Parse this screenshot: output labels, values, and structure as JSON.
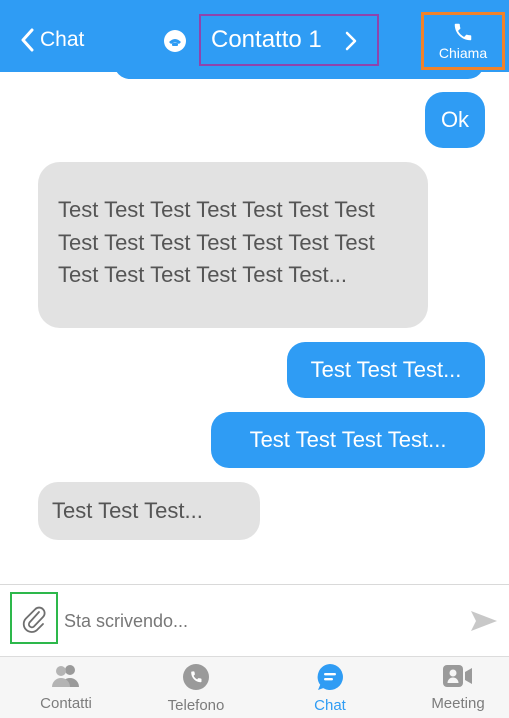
{
  "header": {
    "back_label": "Chat",
    "contact_name": "Contatto 1",
    "call_label": "Chiama",
    "accent": "#2f9cf4"
  },
  "messages": [
    {
      "direction": "outgoing",
      "text": "Ok"
    },
    {
      "direction": "incoming",
      "text": "Test Test Test Test Test Test Test Test Test Test Test Test Test Test Test Test Test Test Test Test..."
    },
    {
      "direction": "outgoing",
      "text": "Test Test Test..."
    },
    {
      "direction": "outgoing",
      "text": "Test Test Test Test..."
    },
    {
      "direction": "incoming",
      "text": "Test Test Test..."
    }
  ],
  "composer": {
    "placeholder": "Sta scrivendo...",
    "attach_icon": "paperclip-icon",
    "send_icon": "send-icon"
  },
  "tabs": [
    {
      "label": "Contatti",
      "icon": "contacts-icon",
      "active": false
    },
    {
      "label": "Telefono",
      "icon": "phone-icon",
      "active": false
    },
    {
      "label": "Chat",
      "icon": "chat-icon",
      "active": true
    },
    {
      "label": "Meeting",
      "icon": "video-icon",
      "active": false
    }
  ]
}
